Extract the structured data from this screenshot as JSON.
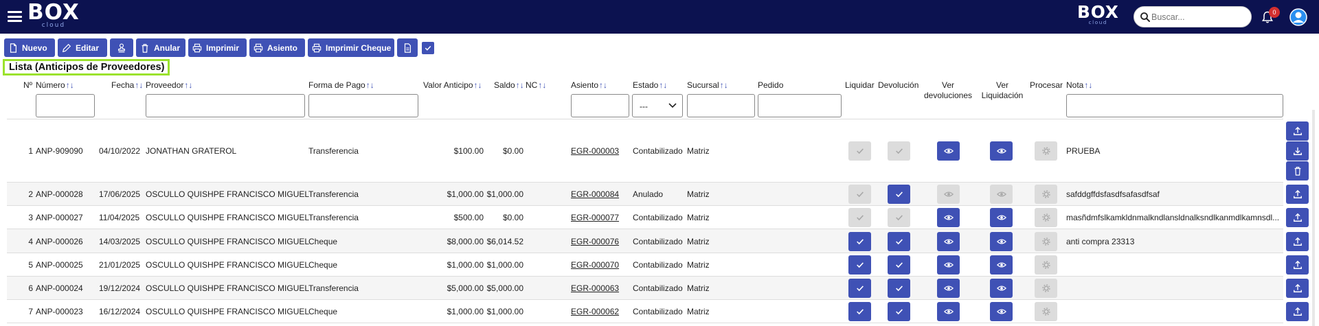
{
  "app": {
    "logo_main": "BOX",
    "logo_sub": "cloud"
  },
  "search": {
    "placeholder": "Buscar..."
  },
  "notifications": {
    "count": "0"
  },
  "toolbar": {
    "nuevo": "Nuevo",
    "editar": "Editar",
    "anular": "Anular",
    "imprimir": "Imprimir",
    "asiento": "Asiento",
    "imprimir_cheque": "Imprimir Cheque"
  },
  "list_title": "Lista (Anticipos de Proveedores)",
  "columns": {
    "no": "Nº",
    "numero": "Número",
    "fecha": "Fecha",
    "proveedor": "Proveedor",
    "forma_pago": "Forma de Pago",
    "valor_anticipo": "Valor Anticipo",
    "saldo": "Saldo",
    "nc": "NC",
    "asiento": "Asiento",
    "estado": "Estado",
    "sucursal": "Sucursal",
    "pedido": "Pedido",
    "liquidar": "Liquidar",
    "devolucion": "Devolución",
    "ver_devoluciones_1": "Ver",
    "ver_devoluciones_2": "devoluciones",
    "ver_liquidacion_1": "Ver",
    "ver_liquidacion_2": "Liquidación",
    "procesar": "Procesar",
    "nota": "Nota"
  },
  "filters": {
    "estado_selected": "---"
  },
  "rows": [
    {
      "no": "1",
      "numero": "ANP-909090",
      "fecha": "04/10/2022",
      "proveedor": "JONATHAN GRATEROL",
      "forma_pago": "Transferencia",
      "valor": "$100.00",
      "saldo": "$0.00",
      "asiento": "EGR-000003",
      "estado": "Contabilizado",
      "sucursal": "Matriz",
      "nota": "PRUEBA",
      "liquidar": false,
      "devolucion": false,
      "ver_dev": true,
      "ver_liq": true
    },
    {
      "no": "2",
      "numero": "ANP-000028",
      "fecha": "17/06/2025",
      "proveedor": "OSCULLO QUISHPE FRANCISCO MIGUEL",
      "forma_pago": "Transferencia",
      "valor": "$1,000.00",
      "saldo": "$1,000.00",
      "asiento": "EGR-000084",
      "estado": "Anulado",
      "sucursal": "Matriz",
      "nota": "safddgffdsfasdfsafasdfsaf",
      "liquidar": false,
      "devolucion": true,
      "ver_dev": false,
      "ver_liq": false
    },
    {
      "no": "3",
      "numero": "ANP-000027",
      "fecha": "11/04/2025",
      "proveedor": "OSCULLO QUISHPE FRANCISCO MIGUEL",
      "forma_pago": "Transferencia",
      "valor": "$500.00",
      "saldo": "$0.00",
      "asiento": "EGR-000077",
      "estado": "Contabilizado",
      "sucursal": "Matriz",
      "nota": "masñdmfslkamkldnmalkndlansldnalksndlkanmdlkamnsdl...",
      "liquidar": false,
      "devolucion": false,
      "ver_dev": true,
      "ver_liq": true
    },
    {
      "no": "4",
      "numero": "ANP-000026",
      "fecha": "14/03/2025",
      "proveedor": "OSCULLO QUISHPE FRANCISCO MIGUEL",
      "forma_pago": "Cheque",
      "valor": "$8,000.00",
      "saldo": "$6,014.52",
      "asiento": "EGR-000076",
      "estado": "Contabilizado",
      "sucursal": "Matriz",
      "nota": "anti compra 23313",
      "liquidar": true,
      "devolucion": true,
      "ver_dev": true,
      "ver_liq": true
    },
    {
      "no": "5",
      "numero": "ANP-000025",
      "fecha": "21/01/2025",
      "proveedor": "OSCULLO QUISHPE FRANCISCO MIGUEL",
      "forma_pago": "Cheque",
      "valor": "$1,000.00",
      "saldo": "$1,000.00",
      "asiento": "EGR-000070",
      "estado": "Contabilizado",
      "sucursal": "Matriz",
      "nota": "",
      "liquidar": true,
      "devolucion": true,
      "ver_dev": true,
      "ver_liq": true
    },
    {
      "no": "6",
      "numero": "ANP-000024",
      "fecha": "19/12/2024",
      "proveedor": "OSCULLO QUISHPE FRANCISCO MIGUEL",
      "forma_pago": "Transferencia",
      "valor": "$5,000.00",
      "saldo": "$5,000.00",
      "asiento": "EGR-000063",
      "estado": "Contabilizado",
      "sucursal": "Matriz",
      "nota": "",
      "liquidar": true,
      "devolucion": true,
      "ver_dev": true,
      "ver_liq": true
    },
    {
      "no": "7",
      "numero": "ANP-000023",
      "fecha": "16/12/2024",
      "proveedor": "OSCULLO QUISHPE FRANCISCO MIGUEL",
      "forma_pago": "Cheque",
      "valor": "$1,000.00",
      "saldo": "$1,000.00",
      "asiento": "EGR-000062",
      "estado": "Contabilizado",
      "sucursal": "Matriz",
      "nota": "",
      "liquidar": true,
      "devolucion": true,
      "ver_dev": true,
      "ver_liq": true
    }
  ],
  "colors": {
    "topbar": "#0c1250",
    "primary": "#3f51b5",
    "disabled": "#dcdcdc",
    "highlight": "#9be22d",
    "badge": "#d32f2f"
  }
}
